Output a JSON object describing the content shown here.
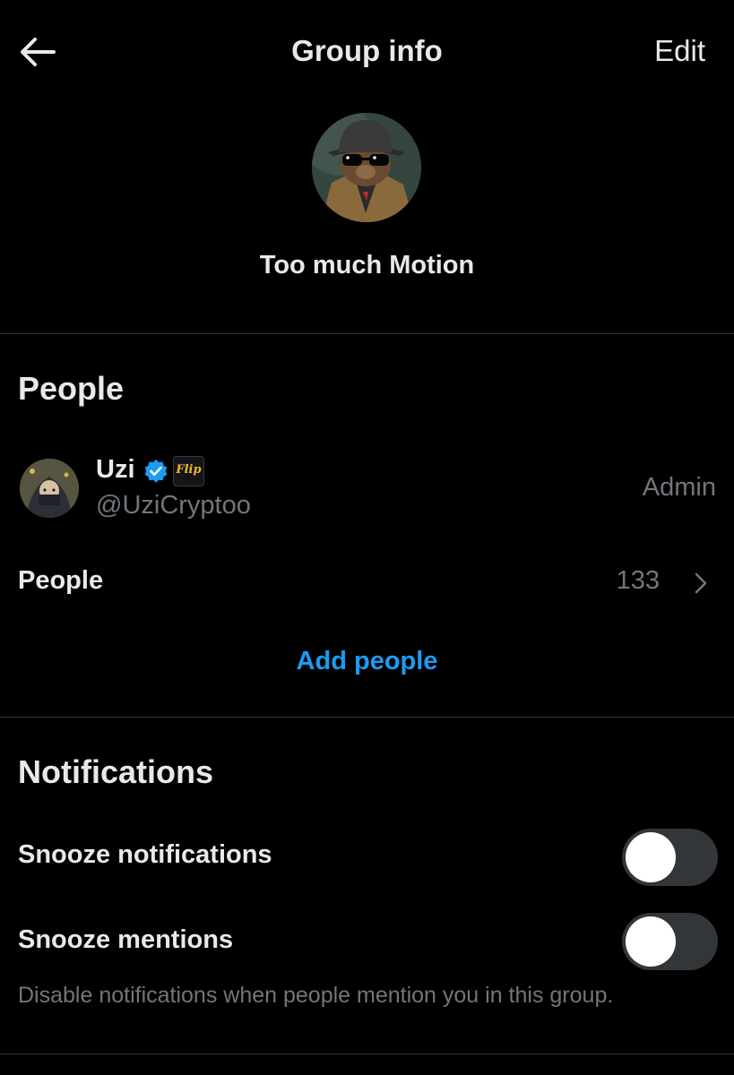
{
  "header": {
    "title": "Group info",
    "edit_label": "Edit"
  },
  "group": {
    "name": "Too much Motion"
  },
  "people_section": {
    "title": "People",
    "members": [
      {
        "name": "Uzi",
        "handle": "@UziCryptoo",
        "role": "Admin",
        "badge_text": "Flip"
      }
    ],
    "people_row_label": "People",
    "people_count": "133",
    "add_people_label": "Add people"
  },
  "notifications_section": {
    "title": "Notifications",
    "snooze_notifications_label": "Snooze notifications",
    "snooze_notifications_on": false,
    "snooze_mentions_label": "Snooze mentions",
    "snooze_mentions_on": false,
    "snooze_mentions_help": "Disable notifications when people mention you in this group."
  },
  "colors": {
    "background": "#000000",
    "text_primary": "#e7e9ea",
    "text_secondary": "#71767b",
    "accent": "#1d9bf0",
    "divider": "#2f3336",
    "toggle_track": "#333639"
  },
  "icons": {
    "back": "arrow-left-icon",
    "verified": "verified-badge-icon",
    "chevron": "chevron-right-icon"
  }
}
